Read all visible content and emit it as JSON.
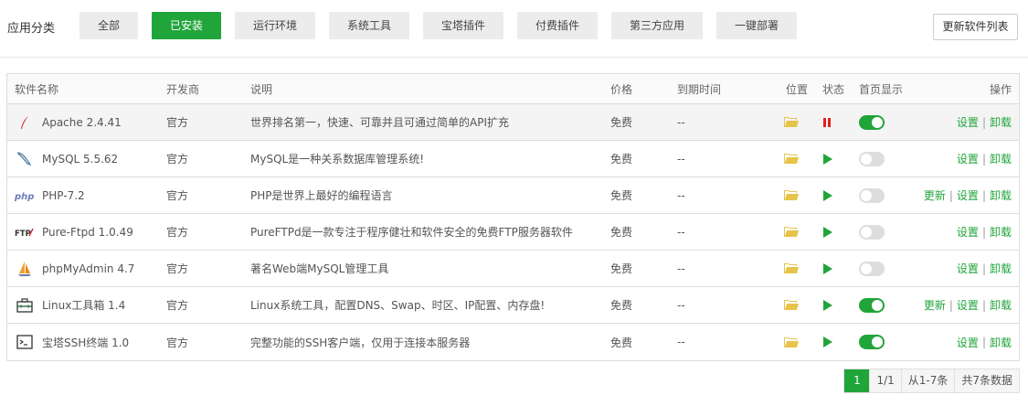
{
  "categories": {
    "label": "应用分类",
    "items": [
      "全部",
      "已安装",
      "运行环境",
      "系统工具",
      "宝塔插件",
      "付费插件",
      "第三方应用",
      "一键部署"
    ],
    "active_index": 1
  },
  "refresh_label": "更新软件列表",
  "table": {
    "headers": {
      "name": "软件名称",
      "developer": "开发商",
      "description": "说明",
      "price": "价格",
      "expiry": "到期时间",
      "location": "位置",
      "status": "状态",
      "home": "首页显示",
      "ops": "操作"
    },
    "rows": [
      {
        "icon": "apache-feather-icon",
        "name": "Apache 2.4.41",
        "developer": "官方",
        "description": "世界排名第一，快速、可靠并且可通过简单的API扩充",
        "price": "免费",
        "expiry": "--",
        "status": "running",
        "home": true,
        "ops": [
          "设置",
          "卸载"
        ]
      },
      {
        "icon": "mysql-dolphin-icon",
        "name": "MySQL 5.5.62",
        "developer": "官方",
        "description": "MySQL是一种关系数据库管理系统!",
        "price": "免费",
        "expiry": "--",
        "status": "stopped",
        "home": false,
        "ops": [
          "设置",
          "卸载"
        ]
      },
      {
        "icon": "php-logo-icon",
        "name": "PHP-7.2",
        "developer": "官方",
        "description": "PHP是世界上最好的编程语言",
        "price": "免费",
        "expiry": "--",
        "status": "stopped",
        "home": false,
        "ops": [
          "更新",
          "设置",
          "卸载"
        ]
      },
      {
        "icon": "ftp-logo-icon",
        "name": "Pure-Ftpd 1.0.49",
        "developer": "官方",
        "description": "PureFTPd是一款专注于程序健壮和软件安全的免费FTP服务器软件",
        "price": "免费",
        "expiry": "--",
        "status": "stopped",
        "home": false,
        "ops": [
          "设置",
          "卸载"
        ]
      },
      {
        "icon": "phpmyadmin-sail-icon",
        "name": "phpMyAdmin 4.7",
        "developer": "官方",
        "description": "著名Web端MySQL管理工具",
        "price": "免费",
        "expiry": "--",
        "status": "stopped",
        "home": false,
        "ops": [
          "设置",
          "卸载"
        ]
      },
      {
        "icon": "toolbox-icon",
        "name": "Linux工具箱 1.4",
        "developer": "官方",
        "description": "Linux系统工具，配置DNS、Swap、时区、IP配置、内存盘!",
        "price": "免费",
        "expiry": "--",
        "status": "stopped",
        "home": true,
        "ops": [
          "更新",
          "设置",
          "卸载"
        ]
      },
      {
        "icon": "terminal-icon",
        "name": "宝塔SSH终端 1.0",
        "developer": "官方",
        "description": "完整功能的SSH客户端，仅用于连接本服务器",
        "price": "免费",
        "expiry": "--",
        "status": "stopped",
        "home": true,
        "ops": [
          "设置",
          "卸载"
        ]
      }
    ]
  },
  "pagination": {
    "current": "1",
    "pages": "1/1",
    "range": "从1-7条",
    "total": "共7条数据"
  },
  "colors": {
    "accent": "#20a53a",
    "folder": "#e6c44a",
    "stop": "#e02020",
    "link": "#20a53a"
  }
}
